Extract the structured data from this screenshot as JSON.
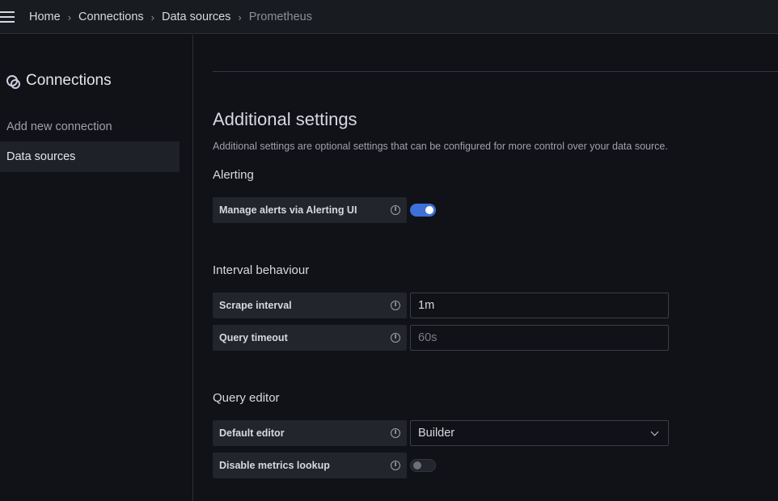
{
  "breadcrumb": {
    "home": "Home",
    "connections": "Connections",
    "data_sources": "Data sources",
    "current": "Prometheus"
  },
  "sidebar": {
    "title": "Connections",
    "items": [
      {
        "label": "Add new connection"
      },
      {
        "label": "Data sources"
      }
    ]
  },
  "main": {
    "title": "Additional settings",
    "description": "Additional settings are optional settings that can be configured for more control over your data source.",
    "alerting": {
      "heading": "Alerting",
      "manage_alerts_label": "Manage alerts via Alerting UI",
      "manage_alerts_enabled": true
    },
    "interval": {
      "heading": "Interval behaviour",
      "scrape_label": "Scrape interval",
      "scrape_value": "1m",
      "timeout_label": "Query timeout",
      "timeout_placeholder": "60s"
    },
    "query_editor": {
      "heading": "Query editor",
      "default_editor_label": "Default editor",
      "default_editor_value": "Builder",
      "disable_metrics_label": "Disable metrics lookup",
      "disable_metrics_enabled": false
    }
  },
  "colors": {
    "accent": "#3d71d9",
    "background": "#111217",
    "panel": "#22252b"
  }
}
